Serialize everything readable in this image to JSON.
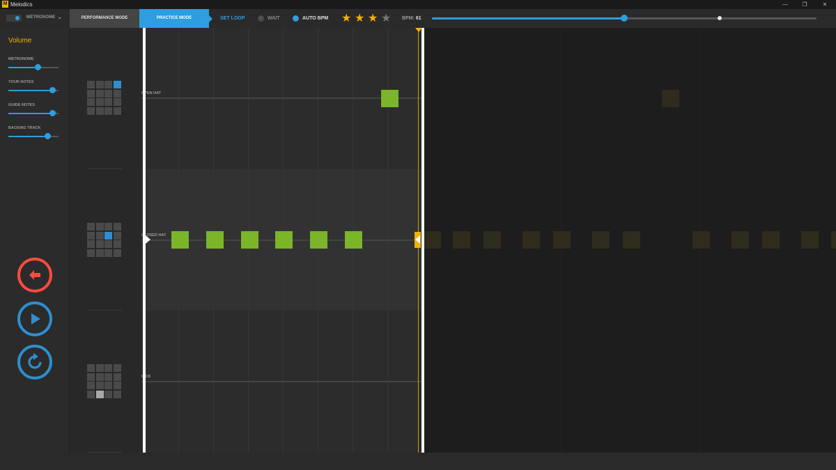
{
  "window": {
    "title": "Melodics",
    "logo_letter": "M",
    "controls": {
      "minimize": "—",
      "restore": "❐",
      "close": "✕"
    }
  },
  "toolbar": {
    "metronome_label": "METRONOME",
    "metronome_on": true,
    "tabs": [
      {
        "label": "PERFORMANCE MODE",
        "active": false
      },
      {
        "label": "PRACTICE MODE",
        "active": true
      }
    ],
    "set_loop": "SET LOOP",
    "wait": {
      "label": "WAIT",
      "enabled": false
    },
    "auto_bpm": {
      "label": "AUTO BPM",
      "enabled": true
    },
    "stars": {
      "earned": 3,
      "total": 4
    },
    "bpm_label": "BPM:",
    "bpm_value": "61",
    "tempo_progress": 0.5,
    "tempo_marker": 0.748
  },
  "volume": {
    "title": "Volume",
    "sliders": [
      {
        "label": "METRONOME",
        "level": 0.58
      },
      {
        "label": "YOUR NOTES",
        "level": 0.88
      },
      {
        "label": "GUIDE NOTES",
        "level": 0.88
      },
      {
        "label": "BACKING TRACK",
        "level": 0.78
      }
    ]
  },
  "transport": {
    "back": "back-arrow-icon",
    "play": "play-icon",
    "restart": "restart-icon"
  },
  "lanes": [
    {
      "label": "OPEN HAT",
      "pad_highlight": {
        "row": 0,
        "col": 3,
        "color": "blue"
      }
    },
    {
      "label": "CLOSED HAT",
      "pad_highlight": {
        "row": 1,
        "col": 2,
        "color": "blue"
      }
    },
    {
      "label": "KICK",
      "pad_highlight": {
        "row": 3,
        "col": 1,
        "color": "gray"
      }
    }
  ],
  "colors": {
    "accent_blue": "#2d9ee0",
    "highlight_yellow": "#f0b400",
    "note_green": "#7ab52a",
    "back_red": "#ff4b3e"
  }
}
